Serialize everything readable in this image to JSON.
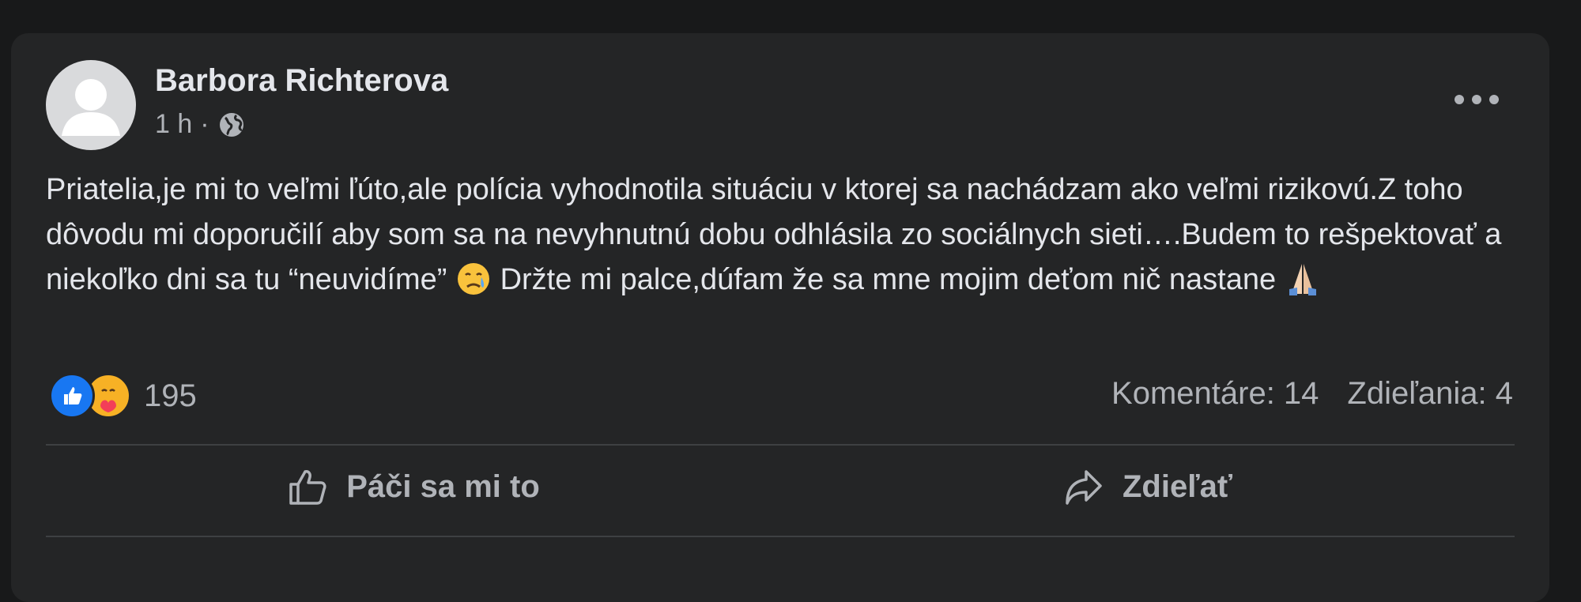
{
  "post": {
    "author": "Barbora Richterova",
    "time": "1 h",
    "separator": "·",
    "privacy_icon": "globe-icon",
    "more_icon": "more-options-icon",
    "text": {
      "part1": "Priatelia,je mi to veľmi ľúto,ale polícia vyhodnotila situáciu v ktorej sa nachádzam ako veľmi rizikovú.Z toho dôvodu mi doporučilí aby som sa na nevyhnutnú dobu odhlásila zo sociálnych sieti….Budem to rešpektovať a niekoľko dni sa tu “neuvidíme” ",
      "emoji1": "crying-face-emoji",
      "part2": " Držte mi palce,dúfam že sa mne mojim deťom nič nastane ",
      "emoji2": "folded-hands-emoji"
    }
  },
  "engagement": {
    "reaction_icons": [
      "like-reaction-icon",
      "care-reaction-icon"
    ],
    "reaction_count": "195",
    "comments": "Komentáre: 14",
    "shares": "Zdieľania: 4"
  },
  "actions": {
    "like_label": "Páči sa mi to",
    "share_label": "Zdieľať"
  },
  "colors": {
    "page_bg": "#18191a",
    "card_bg": "#242526",
    "primary_text": "#e4e6eb",
    "secondary_text": "#b0b3b8",
    "like_blue": "#1877f2",
    "care_yellow": "#f7b125"
  }
}
